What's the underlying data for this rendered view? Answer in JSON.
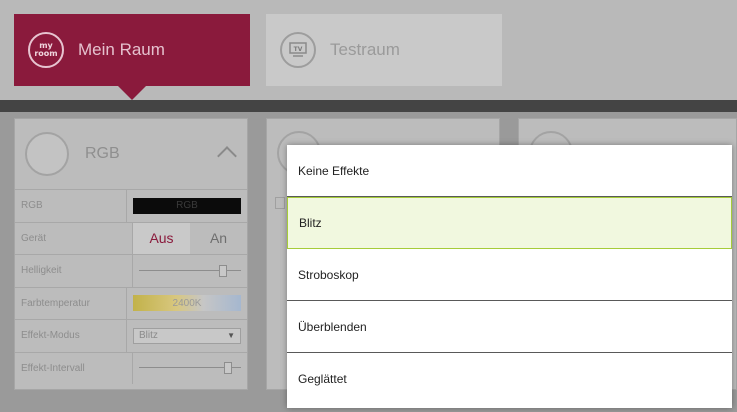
{
  "rooms": [
    {
      "icon": "my-room-icon",
      "icon_text": "my\nroom",
      "label": "Mein Raum",
      "active": true
    },
    {
      "icon": "tv-icon",
      "icon_text": "TV",
      "label": "Testraum",
      "active": false
    }
  ],
  "device_card": {
    "title": "RGB",
    "properties": {
      "rgb": {
        "label": "RGB",
        "value": "RGB"
      },
      "device": {
        "label": "Gerät",
        "off_label": "Aus",
        "on_label": "An",
        "state": "Aus"
      },
      "brightness": {
        "label": "Helligkeit",
        "level": 0.85
      },
      "color_temp": {
        "label": "Farbtemperatur",
        "value": "2400K"
      },
      "effect_mode": {
        "label": "Effekt-Modus",
        "value": "Blitz"
      },
      "effect_interval": {
        "label": "Effekt-Intervall",
        "level": 0.9
      }
    }
  },
  "dropdown": {
    "selected": "Blitz",
    "options": [
      "Keine Effekte",
      "Blitz",
      "Stroboskop",
      "Überblenden",
      "Geglättet"
    ]
  },
  "colors": {
    "accent": "#8a1a3c",
    "selection_border": "#a6cc39",
    "selection_fill": "#f1f8df"
  }
}
